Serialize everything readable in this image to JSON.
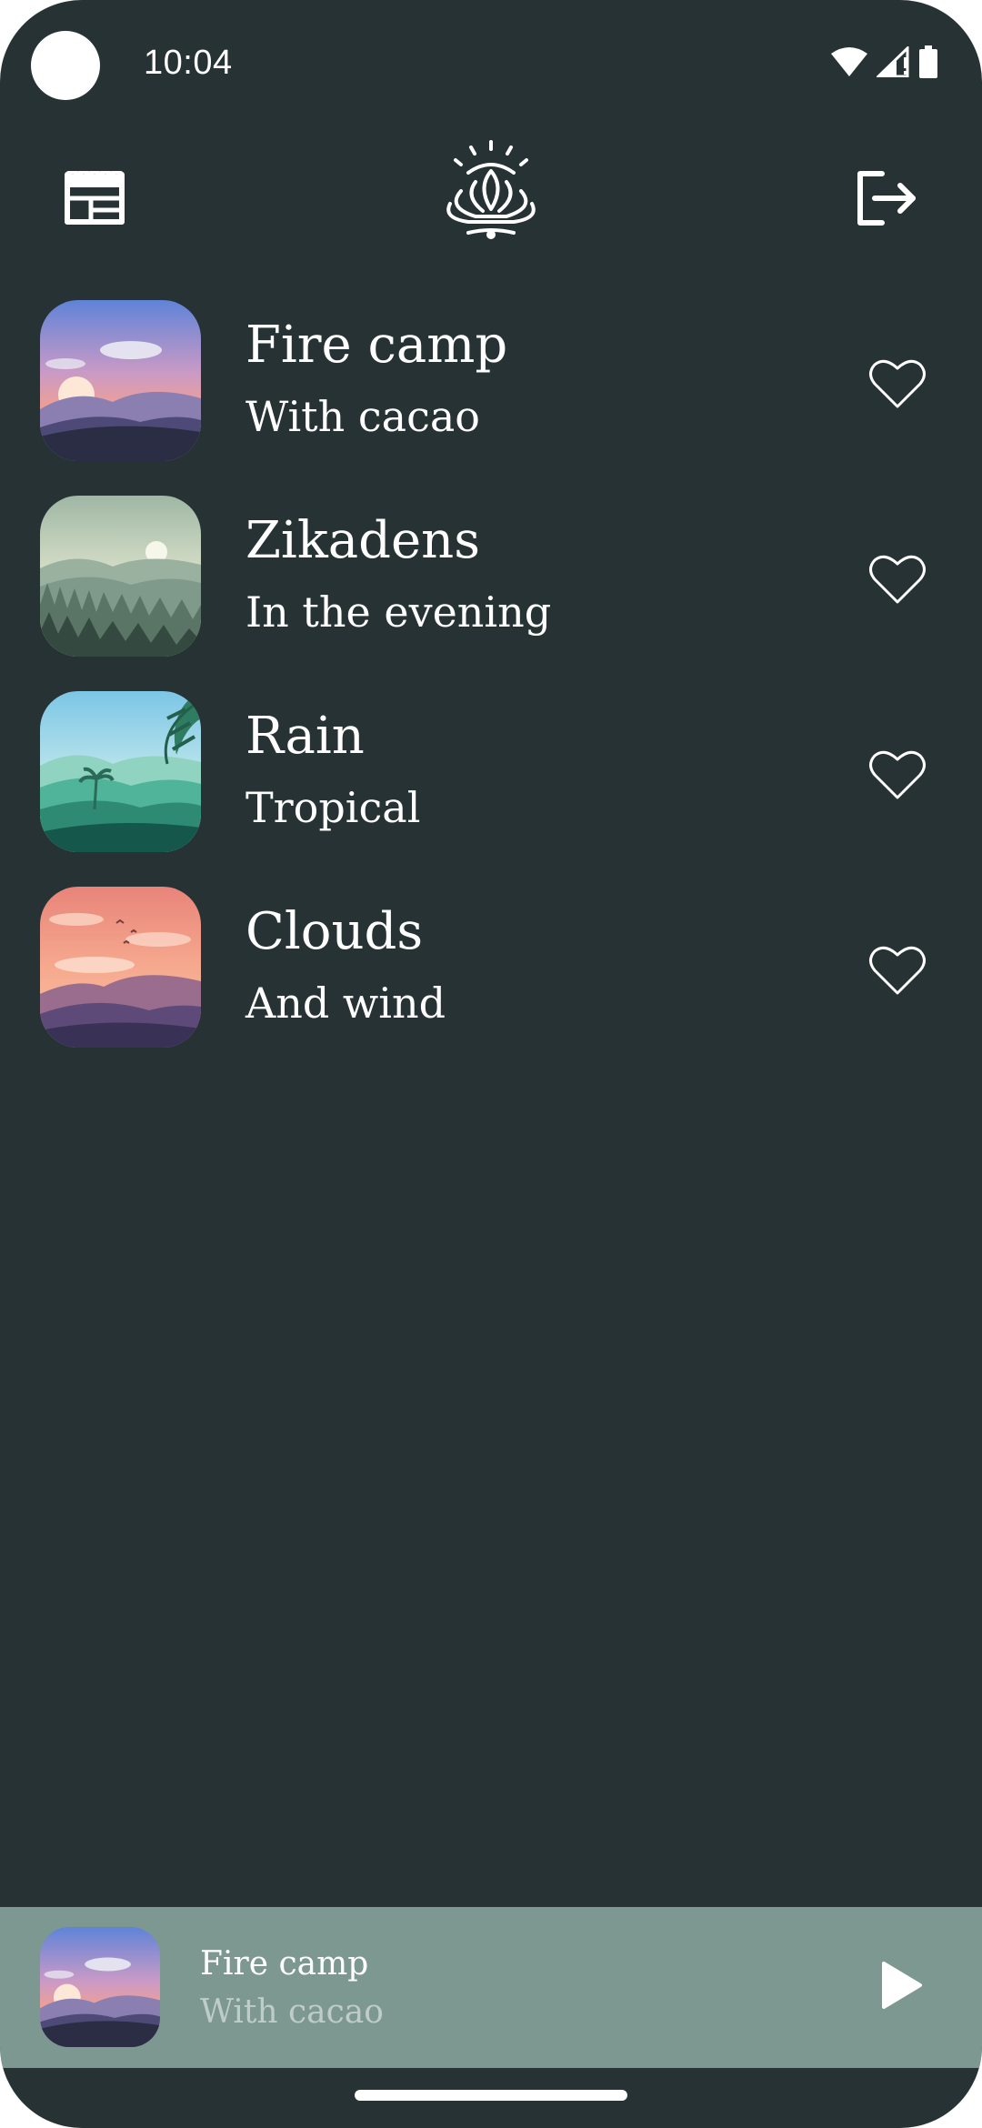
{
  "status_bar": {
    "time": "10:04"
  },
  "top_bar": {
    "left_icon": "calendar-icon",
    "center_icon": "lotus-logo-icon",
    "right_icon": "logout-icon"
  },
  "tracks": [
    {
      "title": "Fire camp",
      "subtitle": "With cacao",
      "thumbnail": "sunset-landscape",
      "favorite": false
    },
    {
      "title": "Zikadens",
      "subtitle": "In the evening",
      "thumbnail": "forest-mountains",
      "favorite": false
    },
    {
      "title": "Rain",
      "subtitle": "Tropical",
      "thumbnail": "tropical-jungle",
      "favorite": false
    },
    {
      "title": "Clouds",
      "subtitle": "And wind",
      "thumbnail": "pink-clouds",
      "favorite": false
    }
  ],
  "now_playing": {
    "title": "Fire camp",
    "subtitle": "With cacao",
    "thumbnail": "sunset-landscape",
    "play_icon": "play-icon"
  },
  "colors": {
    "background": "#263234",
    "mini_player": "#7c9891",
    "text": "#ffffff",
    "muted_text": "#bfccc8"
  }
}
